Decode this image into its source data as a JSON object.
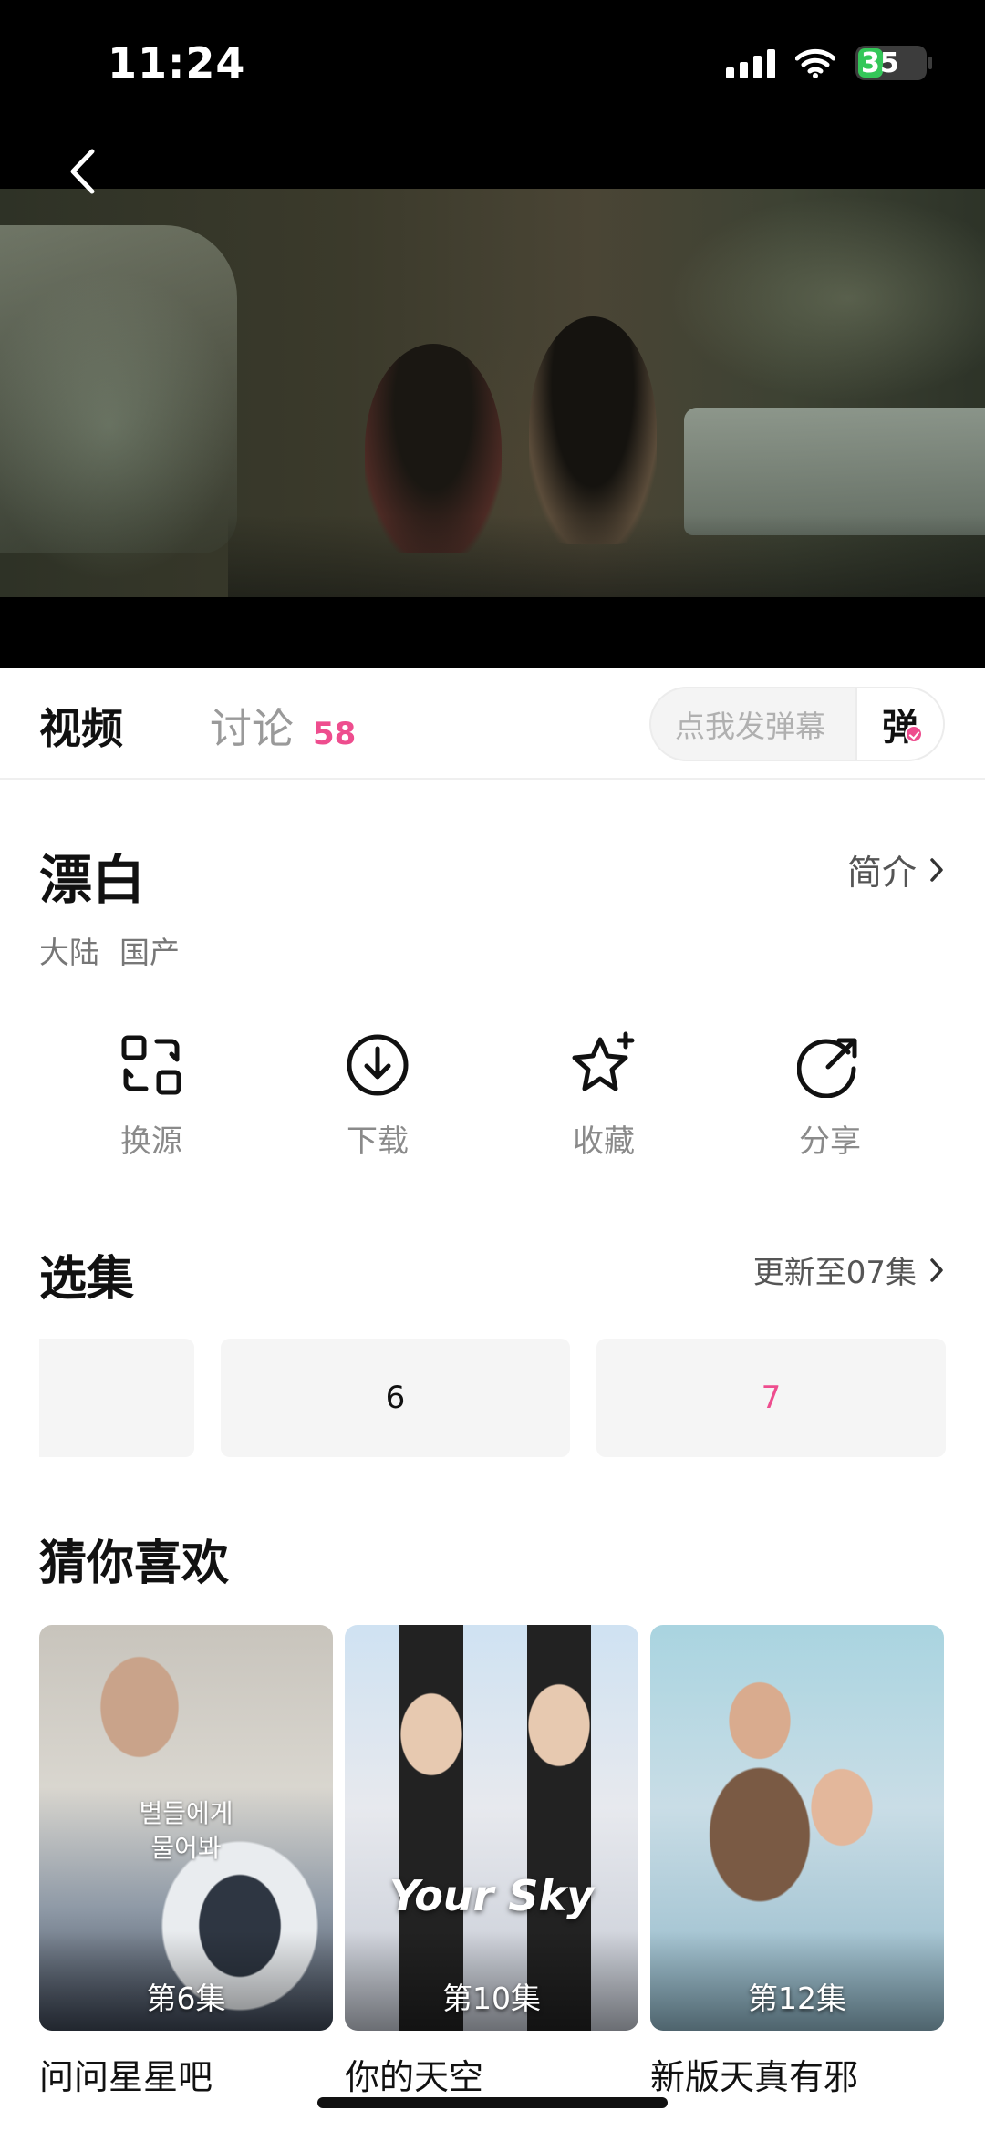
{
  "status_bar": {
    "time": "11:24",
    "battery": "35"
  },
  "tabs": {
    "video": "视频",
    "discuss": "讨论",
    "discuss_count": "58"
  },
  "danmu": {
    "placeholder": "点我发弹幕",
    "button": "弹"
  },
  "show": {
    "title": "漂白",
    "intro_label": "简介",
    "tags": [
      "大陆",
      "国产"
    ]
  },
  "actions": [
    {
      "label": "换源",
      "icon": "switch-source-icon"
    },
    {
      "label": "下载",
      "icon": "download-icon"
    },
    {
      "label": "收藏",
      "icon": "star-icon"
    },
    {
      "label": "分享",
      "icon": "share-icon"
    }
  ],
  "episodes": {
    "title": "选集",
    "update_label": "更新至07集",
    "items": [
      "",
      "6",
      "7"
    ],
    "current": "7"
  },
  "recommend": {
    "title": "猜你喜欢",
    "items": [
      {
        "name": "问问星星吧",
        "badge": "第6集",
        "poster_text": "별들에게\n물어봐"
      },
      {
        "name": "你的天空",
        "badge": "第10集",
        "poster_text": "Your Sky"
      },
      {
        "name": "新版天真有邪",
        "badge": "第12集",
        "poster_text": ""
      }
    ]
  },
  "colors": {
    "accent": "#ee4d8e",
    "text": "#111111",
    "muted": "#8a8a8a"
  }
}
